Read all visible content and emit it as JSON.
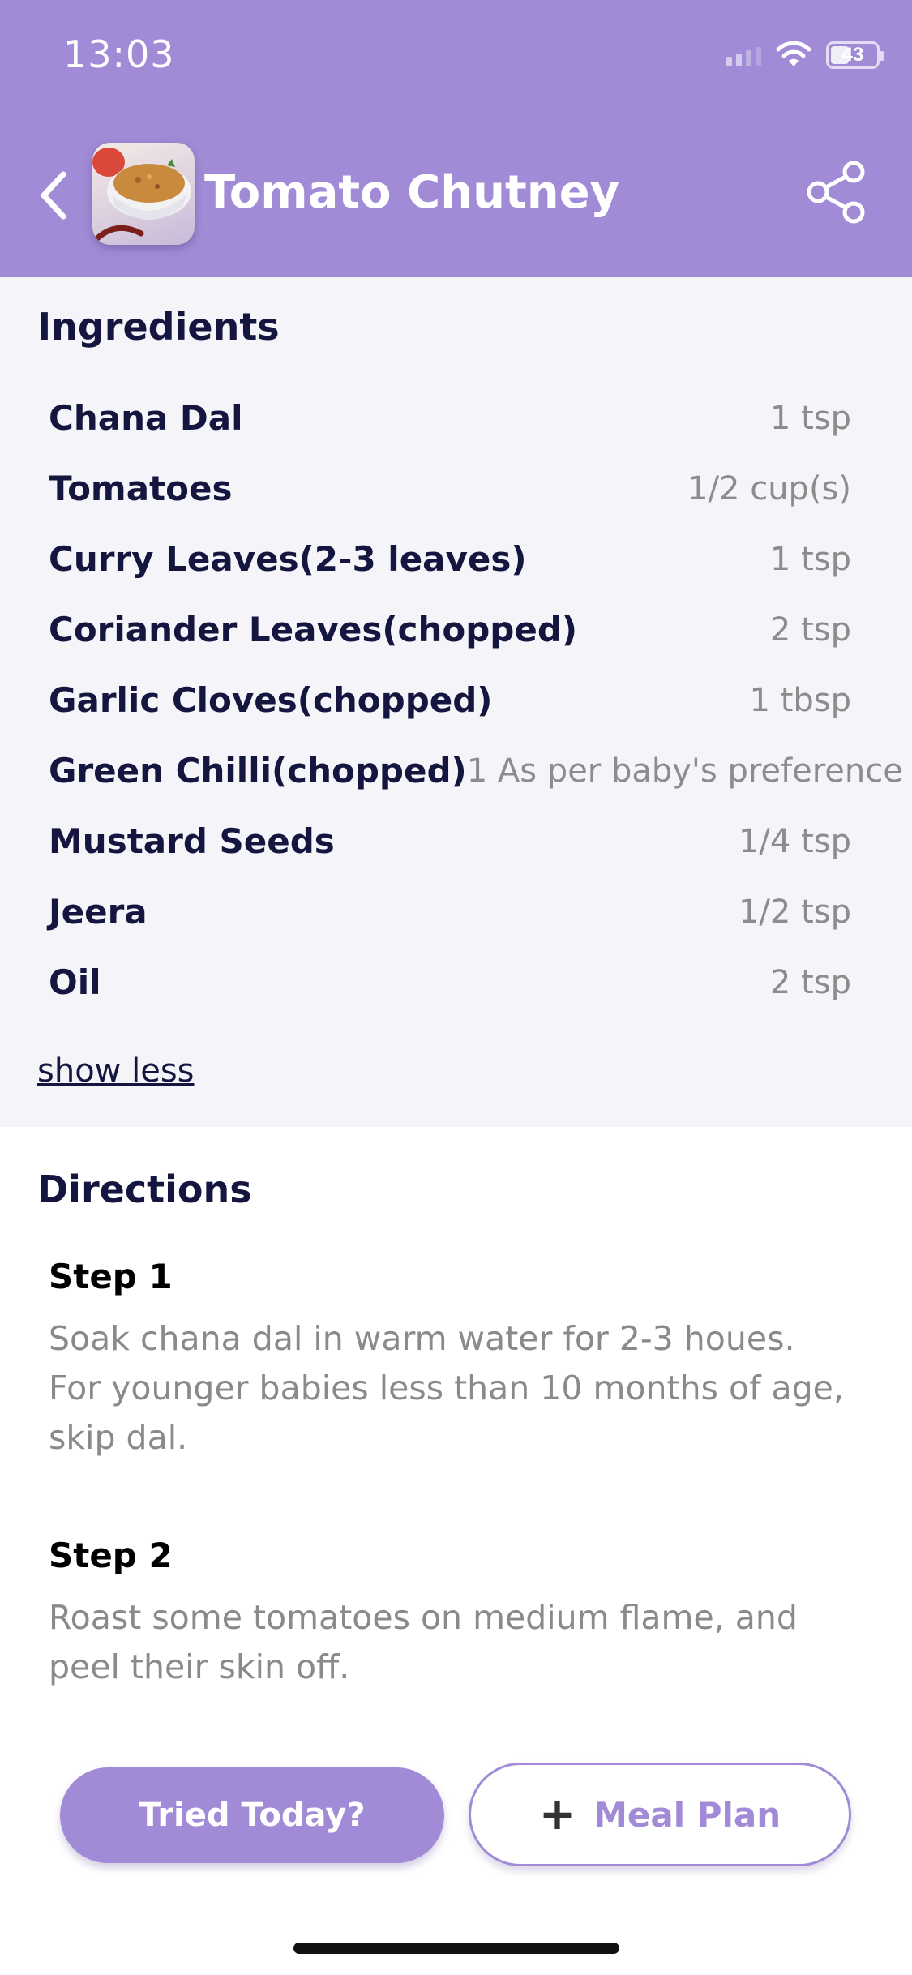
{
  "status_bar": {
    "time": "13:03",
    "battery": "43"
  },
  "header": {
    "title": "Tomato Chutney",
    "back_icon": "chevron-left-icon",
    "share_icon": "share-icon",
    "colors": {
      "accent": "#a18bd6"
    }
  },
  "ingredients": {
    "title": "Ingredients",
    "items": [
      {
        "name": "Chana Dal",
        "qty": "1 tsp"
      },
      {
        "name": "Tomatoes",
        "qty": "1/2 cup(s)"
      },
      {
        "name": "Curry Leaves(2-3 leaves)",
        "qty": "1 tsp"
      },
      {
        "name": "Coriander Leaves(chopped)",
        "qty": "2 tsp"
      },
      {
        "name": "Garlic Cloves(chopped)",
        "qty": "1 tbsp"
      },
      {
        "name": "Green Chilli(chopped)",
        "qty": "1 As per baby's preference"
      },
      {
        "name": "Mustard Seeds",
        "qty": "1/4 tsp"
      },
      {
        "name": "Jeera",
        "qty": "1/2 tsp"
      },
      {
        "name": "Oil",
        "qty": "2 tsp"
      }
    ],
    "toggle_label": "show less"
  },
  "directions": {
    "title": "Directions",
    "steps": [
      {
        "title": "Step 1",
        "text": "Soak chana dal in warm water for 2-3 houes. For younger babies less than 10 months of age, skip dal."
      },
      {
        "title": "Step 2",
        "text": "Roast some tomatoes on medium flame, and peel their skin off."
      }
    ]
  },
  "actions": {
    "tried_label": "Tried Today?",
    "meal_plan_label": "Meal Plan",
    "meal_plan_icon": "plus-icon"
  }
}
